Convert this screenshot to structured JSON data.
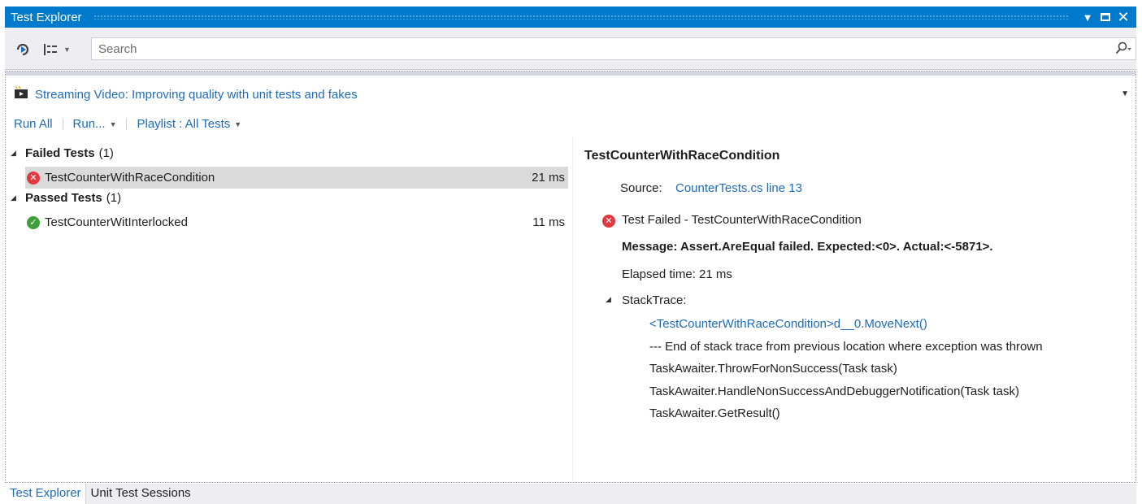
{
  "window": {
    "title": "Test Explorer"
  },
  "toolbar": {
    "search_placeholder": "Search"
  },
  "header": {
    "video_link": "Streaming Video: Improving quality with unit tests and fakes",
    "run_all": "Run All",
    "run": "Run...",
    "playlist": "Playlist : All Tests"
  },
  "groups": [
    {
      "name": "Failed Tests",
      "count": "(1)"
    },
    {
      "name": "Passed Tests",
      "count": "(1)"
    }
  ],
  "tests": [
    {
      "name": "TestCounterWithRaceCondition",
      "duration": "21 ms",
      "status": "failed"
    },
    {
      "name": "TestCounterWitInterlocked",
      "duration": "11 ms",
      "status": "passed"
    }
  ],
  "detail": {
    "title": "TestCounterWithRaceCondition",
    "source_label": "Source:",
    "source_link": "CounterTests.cs line 13",
    "status_text": "Test Failed - TestCounterWithRaceCondition",
    "message": "Message: Assert.AreEqual failed. Expected:<0>. Actual:<-5871>.",
    "elapsed": "Elapsed time: 21 ms",
    "stacktrace_label": "StackTrace:",
    "stack": [
      "<TestCounterWithRaceCondition>d__0.MoveNext()",
      "--- End of stack trace from previous location where exception was thrown",
      "TaskAwaiter.ThrowForNonSuccess(Task task)",
      "TaskAwaiter.HandleNonSuccessAndDebuggerNotification(Task task)",
      "TaskAwaiter.GetResult()"
    ]
  },
  "tabs": [
    {
      "label": "Test Explorer",
      "active": true
    },
    {
      "label": "Unit Test Sessions",
      "active": false
    }
  ],
  "colors": {
    "accent": "#007acc",
    "link": "#1e6bb8",
    "fail": "#e0383c",
    "pass": "#3f9f3b"
  }
}
